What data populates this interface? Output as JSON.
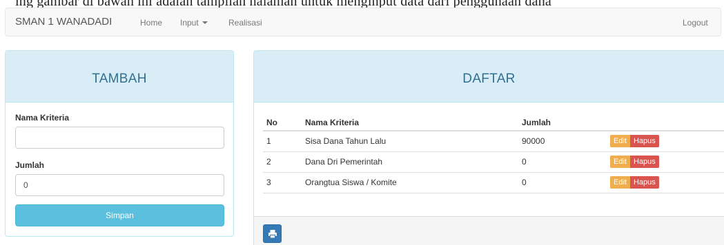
{
  "top_caption": "ing gambar di bawah ini adalah tampilan halaman untuk menginput data dari penggunaan dana",
  "navbar": {
    "brand": "SMAN 1 WANADADI",
    "items": [
      {
        "label": "Home"
      },
      {
        "label": "Input"
      },
      {
        "label": "Realisasi"
      }
    ],
    "logout": "Logout"
  },
  "form_panel": {
    "title": "TAMBAH",
    "fields": [
      {
        "label": "Nama Kriteria",
        "value": ""
      },
      {
        "label": "Jumlah",
        "value": "0"
      }
    ],
    "submit_label": "Simpan"
  },
  "list_panel": {
    "title": "DAFTAR",
    "columns": [
      "No",
      "Nama Kriteria",
      "Jumlah",
      ""
    ],
    "rows": [
      {
        "no": "1",
        "nama": "Sisa Dana Tahun Lalu",
        "jumlah": "90000"
      },
      {
        "no": "2",
        "nama": "Dana Dri Pemerintah",
        "jumlah": "0"
      },
      {
        "no": "3",
        "nama": "Orangtua Siswa / Komite",
        "jumlah": "0"
      }
    ],
    "edit_label": "Edit",
    "delete_label": "Hapus",
    "print_icon": "print-icon"
  },
  "colors": {
    "panel_heading": "#d9edf7",
    "panel_title": "#31708f",
    "submit_button": "#5bc0de",
    "edit_button": "#f0ad4e",
    "delete_button": "#d9534f",
    "print_button": "#337ab7"
  }
}
